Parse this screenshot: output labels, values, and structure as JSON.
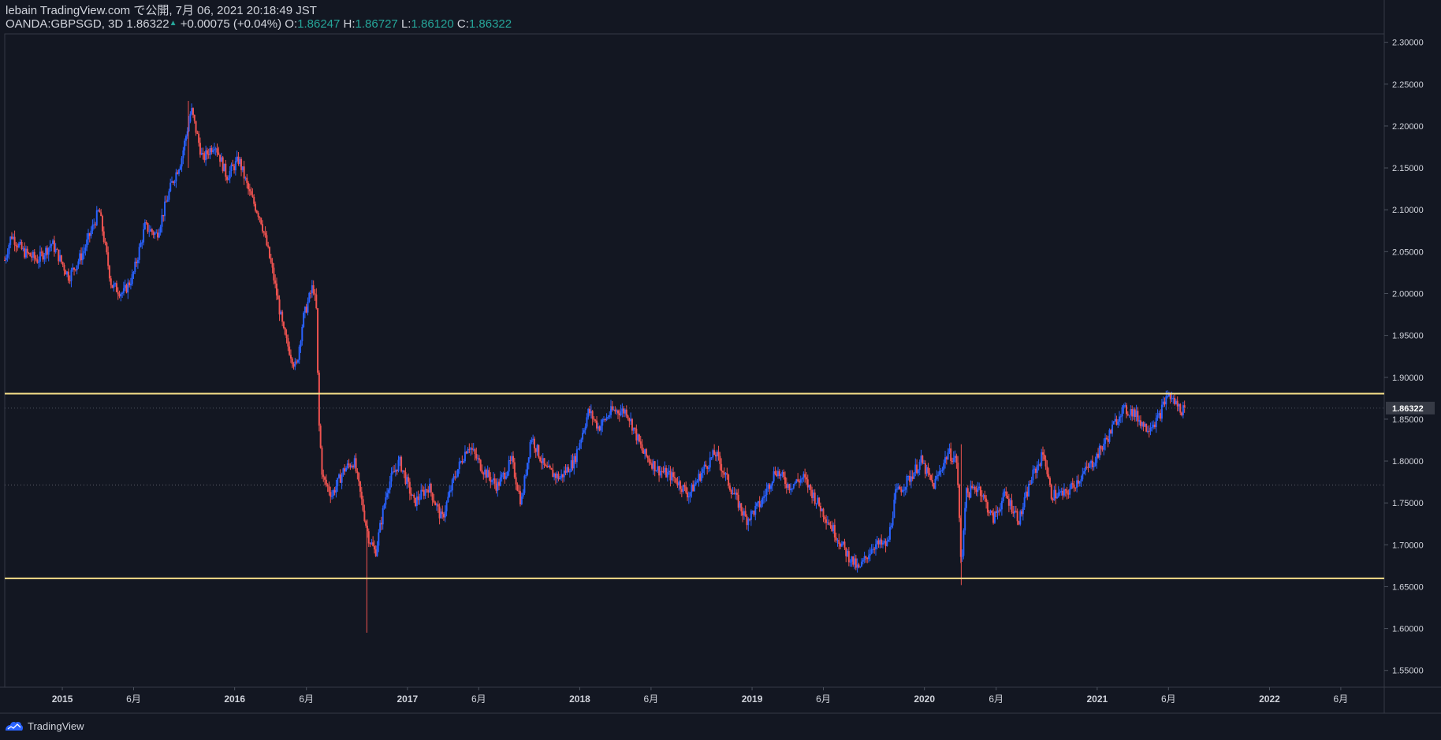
{
  "header": {
    "publisher_line": "lebain TradingView.com で公開, 7月 06, 2021 20:18:49 JST",
    "symbol": "OANDA:GBPSGD, 3D",
    "last": "1.86322",
    "change_arrow": "▲",
    "change": "+0.00075 (+0.04%)",
    "o_label": "O:",
    "o_value": "1.86247",
    "h_label": "H:",
    "h_value": "1.86727",
    "l_label": "L:",
    "l_value": "1.86120",
    "c_label": "C:",
    "c_value": "1.86322"
  },
  "footer": {
    "brand": "TradingView"
  },
  "colors": {
    "background": "#131722",
    "up": "#2962ff",
    "down": "#ef5350",
    "support_resistance": "#f7e08a",
    "price_label_bg": "#363a45",
    "axis_text": "#d1d4dc",
    "grid": "#2a2e39"
  },
  "chart_data": {
    "type": "candlestick",
    "symbol": "OANDA:GBPSGD",
    "timeframe": "3D",
    "y_range": [
      1.53,
      2.31
    ],
    "x_range": [
      "2014-09-01",
      "2022-09-01"
    ],
    "y_ticks": [
      "2.30000",
      "2.25000",
      "2.20000",
      "2.15000",
      "2.10000",
      "2.05000",
      "2.00000",
      "1.95000",
      "1.90000",
      "1.85000",
      "1.80000",
      "1.75000",
      "1.70000",
      "1.65000",
      "1.60000",
      "1.55000"
    ],
    "x_ticks": [
      {
        "label": "2015",
        "date": "2015-01-01",
        "bold": true
      },
      {
        "label": "6月",
        "date": "2015-06-01",
        "bold": false
      },
      {
        "label": "2016",
        "date": "2016-01-01",
        "bold": true
      },
      {
        "label": "6月",
        "date": "2016-06-01",
        "bold": false
      },
      {
        "label": "2017",
        "date": "2017-01-01",
        "bold": true
      },
      {
        "label": "6月",
        "date": "2017-06-01",
        "bold": false
      },
      {
        "label": "2018",
        "date": "2018-01-01",
        "bold": true
      },
      {
        "label": "6月",
        "date": "2018-06-01",
        "bold": false
      },
      {
        "label": "2019",
        "date": "2019-01-01",
        "bold": true
      },
      {
        "label": "6月",
        "date": "2019-06-01",
        "bold": false
      },
      {
        "label": "2020",
        "date": "2020-01-01",
        "bold": true
      },
      {
        "label": "6月",
        "date": "2020-06-01",
        "bold": false
      },
      {
        "label": "2021",
        "date": "2021-01-01",
        "bold": true
      },
      {
        "label": "6月",
        "date": "2021-06-01",
        "bold": false
      },
      {
        "label": "2022",
        "date": "2022-01-01",
        "bold": true
      },
      {
        "label": "6月",
        "date": "2022-06-01",
        "bold": false
      }
    ],
    "current_price": 1.86322,
    "current_price_label": "1.86322",
    "dotted_level": 1.7715,
    "horizontal_lines": [
      {
        "price": 1.8805,
        "name": "resistance"
      },
      {
        "price": 1.66,
        "name": "support"
      }
    ],
    "close_series": {
      "start": "2014-09-01",
      "end": "2021-07-06",
      "points": [
        [
          "2014-09-01",
          2.04
        ],
        [
          "2014-09-15",
          2.07
        ],
        [
          "2014-10-10",
          2.05
        ],
        [
          "2014-11-10",
          2.04
        ],
        [
          "2014-12-10",
          2.06
        ],
        [
          "2015-01-15",
          2.02
        ],
        [
          "2015-02-15",
          2.05
        ],
        [
          "2015-03-20",
          2.1
        ],
        [
          "2015-04-15",
          2.01
        ],
        [
          "2015-05-10",
          2.0
        ],
        [
          "2015-05-30",
          2.02
        ],
        [
          "2015-06-25",
          2.08
        ],
        [
          "2015-07-20",
          2.07
        ],
        [
          "2015-08-20",
          2.13
        ],
        [
          "2015-09-10",
          2.16
        ],
        [
          "2015-10-01",
          2.22
        ],
        [
          "2015-10-25",
          2.16
        ],
        [
          "2015-11-20",
          2.18
        ],
        [
          "2015-12-15",
          2.14
        ],
        [
          "2016-01-10",
          2.16
        ],
        [
          "2016-02-01",
          2.12
        ],
        [
          "2016-02-25",
          2.09
        ],
        [
          "2016-03-20",
          2.03
        ],
        [
          "2016-04-15",
          1.95
        ],
        [
          "2016-05-10",
          1.91
        ],
        [
          "2016-05-25",
          1.97
        ],
        [
          "2016-06-15",
          2.01
        ],
        [
          "2016-06-22",
          1.98
        ],
        [
          "2016-06-27",
          1.85
        ],
        [
          "2016-07-05",
          1.78
        ],
        [
          "2016-07-25",
          1.76
        ],
        [
          "2016-08-20",
          1.79
        ],
        [
          "2016-09-10",
          1.8
        ],
        [
          "2016-10-10",
          1.71
        ],
        [
          "2016-10-25",
          1.69
        ],
        [
          "2016-11-20",
          1.77
        ],
        [
          "2016-12-15",
          1.8
        ],
        [
          "2017-01-15",
          1.75
        ],
        [
          "2017-02-15",
          1.77
        ],
        [
          "2017-03-15",
          1.73
        ],
        [
          "2017-04-10",
          1.78
        ],
        [
          "2017-05-10",
          1.82
        ],
        [
          "2017-06-10",
          1.79
        ],
        [
          "2017-07-10",
          1.77
        ],
        [
          "2017-08-10",
          1.8
        ],
        [
          "2017-08-30",
          1.75
        ],
        [
          "2017-09-20",
          1.83
        ],
        [
          "2017-10-20",
          1.79
        ],
        [
          "2017-11-20",
          1.78
        ],
        [
          "2017-12-20",
          1.8
        ],
        [
          "2018-01-20",
          1.86
        ],
        [
          "2018-02-10",
          1.84
        ],
        [
          "2018-03-10",
          1.86
        ],
        [
          "2018-04-10",
          1.86
        ],
        [
          "2018-05-15",
          1.81
        ],
        [
          "2018-06-15",
          1.79
        ],
        [
          "2018-07-20",
          1.78
        ],
        [
          "2018-08-20",
          1.76
        ],
        [
          "2018-09-20",
          1.79
        ],
        [
          "2018-10-15",
          1.81
        ],
        [
          "2018-11-15",
          1.77
        ],
        [
          "2018-12-20",
          1.73
        ],
        [
          "2019-01-20",
          1.75
        ],
        [
          "2019-02-20",
          1.79
        ],
        [
          "2019-03-20",
          1.77
        ],
        [
          "2019-04-20",
          1.78
        ],
        [
          "2019-05-20",
          1.75
        ],
        [
          "2019-06-20",
          1.72
        ],
        [
          "2019-07-20",
          1.69
        ],
        [
          "2019-08-15",
          1.67
        ],
        [
          "2019-09-15",
          1.7
        ],
        [
          "2019-10-15",
          1.7
        ],
        [
          "2019-11-01",
          1.76
        ],
        [
          "2019-12-01",
          1.78
        ],
        [
          "2019-12-25",
          1.8
        ],
        [
          "2020-01-20",
          1.77
        ],
        [
          "2020-02-20",
          1.81
        ],
        [
          "2020-03-10",
          1.8
        ],
        [
          "2020-03-19",
          1.67
        ],
        [
          "2020-03-28",
          1.76
        ],
        [
          "2020-04-25",
          1.77
        ],
        [
          "2020-05-25",
          1.73
        ],
        [
          "2020-06-20",
          1.76
        ],
        [
          "2020-07-20",
          1.73
        ],
        [
          "2020-08-15",
          1.78
        ],
        [
          "2020-09-10",
          1.81
        ],
        [
          "2020-09-25",
          1.76
        ],
        [
          "2020-10-25",
          1.76
        ],
        [
          "2020-11-25",
          1.78
        ],
        [
          "2020-12-25",
          1.8
        ],
        [
          "2021-01-25",
          1.83
        ],
        [
          "2021-02-20",
          1.86
        ],
        [
          "2021-03-15",
          1.86
        ],
        [
          "2021-04-15",
          1.84
        ],
        [
          "2021-05-10",
          1.85
        ],
        [
          "2021-05-30",
          1.88
        ],
        [
          "2021-06-15",
          1.87
        ],
        [
          "2021-06-30",
          1.86
        ],
        [
          "2021-07-06",
          1.86322
        ]
      ]
    }
  }
}
